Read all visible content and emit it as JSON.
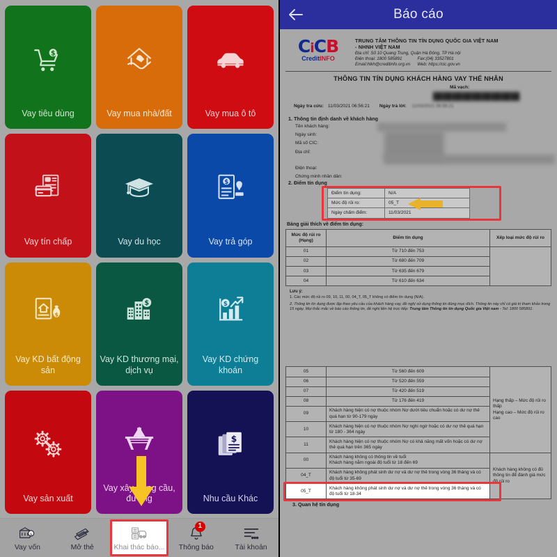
{
  "left_app": {
    "tiles": [
      {
        "label": "Vay tiêu dùng",
        "bg": "#11731b",
        "fg": "#cfe6cf",
        "icon": "shopping-cart-money-icon"
      },
      {
        "label": "Vay mua nhà/đất",
        "bg": "#d96c0a",
        "fg": "#fbe6cf",
        "icon": "house-hand-icon"
      },
      {
        "label": "Vay mua ô tô",
        "bg": "#cf0c12",
        "fg": "#f6d3d4",
        "icon": "car-icon"
      },
      {
        "label": "Vay tín chấp",
        "bg": "#c3111a",
        "fg": "#f5d3d5",
        "icon": "credit-card-document-icon"
      },
      {
        "label": "Vay du học",
        "bg": "#0d4b52",
        "fg": "#cfe3e5",
        "icon": "graduation-cap-icon"
      },
      {
        "label": "Vay trả góp",
        "bg": "#0b49a8",
        "fg": "#d5e2f4",
        "icon": "document-money-stamp-icon"
      },
      {
        "label": "Vay KD bất động sản",
        "bg": "#cc8b07",
        "fg": "#f8ebc8",
        "icon": "house-document-moneybag-icon"
      },
      {
        "label": "Vay KD thương mại, dịch vụ",
        "bg": "#0a5742",
        "fg": "#cfe5dd",
        "icon": "buildings-coin-icon"
      },
      {
        "label": "Vay KD chứng khoán",
        "bg": "#0d7e95",
        "fg": "#d3eaf0",
        "icon": "bar-chart-coin-icon"
      },
      {
        "label": "Vay sản xuất",
        "bg": "#c3090f",
        "fg": "#f6d2d3",
        "icon": "gears-icon"
      },
      {
        "label": "Vay xây dựng cầu, đường",
        "bg": "#7d1186",
        "fg": "#efd6f2",
        "icon": "bridge-road-icon"
      },
      {
        "label": "Nhu cầu Khác",
        "bg": "#141154",
        "fg": "#d5d4e8",
        "icon": "documents-money-icon"
      }
    ],
    "bottom_nav": [
      {
        "label": "Vay vốn",
        "icon": "bank-money-icon",
        "badge": null,
        "highlighted": false
      },
      {
        "label": "Mở thẻ",
        "icon": "cards-icon",
        "badge": null,
        "highlighted": false
      },
      {
        "label": "Khai thác báo...",
        "icon": "report-extract-icon",
        "badge": null,
        "highlighted": true
      },
      {
        "label": "Thông báo",
        "icon": "bell-icon",
        "badge": "1",
        "highlighted": false
      },
      {
        "label": "Tài khoản",
        "icon": "menu-account-icon",
        "badge": null,
        "highlighted": false
      }
    ],
    "annotations": {
      "down_arrow": "down-arrow-pointing-to-khai-thac-bao",
      "arrow_color": "#f7c325",
      "highlight_color": "#e8363c"
    }
  },
  "report": {
    "titlebar": {
      "back": "back-arrow-icon",
      "title": "Báo cáo"
    },
    "logo": {
      "main_c1": "C",
      "main_i": "i",
      "main_c2": "C",
      "main_b": "B",
      "sub_credit": "Credit",
      "sub_info": "INFO"
    },
    "org": {
      "name_line1": "TRUNG TÂM THÔNG TIN TÍN DỤNG QUỐC GIA VIỆT NAM",
      "name_line2": "- NHNH VIỆT NAM",
      "address": "Địa chỉ: Số 10 Quang Trung, Quận Hà Đông, TP Hà nội",
      "phone": "Điện thoại: 1800 585891",
      "fax": "Fax:(04) 33527801",
      "email": "Email:htkh@creditinfo.org.vn",
      "web": "Web: https://cic.gov.vn"
    },
    "doc_heading": "THÔNG TIN TÍN DỤNG KHÁCH HÀNG VAY THỂ NHÂN",
    "meta": {
      "barcode_label": "Mã vạch:",
      "lookup_label": "Ngày tra cứu:",
      "lookup_value": "11/03/2021 06:56:21",
      "reply_label": "Ngày trả lời:",
      "reply_value": "11/03/2021 06:56:21"
    },
    "section1": {
      "heading": "1. Thông tin định danh về khách hàng",
      "fields": [
        "Tên khách hàng:",
        "Ngày sinh:",
        "Mã số CIC:",
        "Địa chỉ:",
        "Điện thoại:",
        "Chứng minh nhân dân:"
      ]
    },
    "section2": {
      "heading": "2. Điểm tín dụng",
      "rows": [
        {
          "key": "Điểm tín dụng:",
          "value": "N/A"
        },
        {
          "key": "Mức độ rủi ro:",
          "value": "05_T"
        },
        {
          "key": "Ngày chấm điểm:",
          "value": "11/03/2021"
        }
      ],
      "table_caption": "Bảng giải thích về điểm tín dụng:",
      "headers": [
        "Mức độ rủi ro (Hạng)",
        "Điểm tín dụng",
        "Xếp loại mức độ rủi ro"
      ],
      "rows_top": [
        {
          "rank": "01",
          "score": "Từ 710 đến 753",
          "class": ""
        },
        {
          "rank": "02",
          "score": "Từ 680 đến 709",
          "class": ""
        },
        {
          "rank": "03",
          "score": "Từ 635 đến 679",
          "class": ""
        },
        {
          "rank": "04",
          "score": "Từ 610 đến 634",
          "class": ""
        }
      ],
      "rows_bottom": [
        {
          "rank": "05",
          "score": "Từ 560 đến 609",
          "center": true
        },
        {
          "rank": "06",
          "score": "Từ 520 đến 559",
          "center": true
        },
        {
          "rank": "07",
          "score": "Từ 420 đến 519",
          "center": true
        },
        {
          "rank": "08",
          "score": "Từ 176 đến 419",
          "center": true
        },
        {
          "rank": "09",
          "score": "Khách hàng hiện có nợ thuộc nhóm Nợ dưới tiêu chuẩn hoặc có dư nợ thẻ quá hạn từ 90-179 ngày",
          "center": false
        },
        {
          "rank": "10",
          "score": "Khách hàng hiện có nợ thuộc nhóm Nợ nghi ngờ hoặc có dư nợ thẻ quá hạn từ 180 - 364 ngày",
          "center": false
        },
        {
          "rank": "11",
          "score": "Khách hàng hiện có nợ thuộc nhóm Nợ có khả năng mất vốn hoặc có dư nợ thẻ quá hạn trên 365 ngày",
          "center": false
        },
        {
          "rank": "00",
          "score": "Khách hàng không có thông tin về tuổi\nKhách hàng nằm ngoài độ tuổi từ 18 đến 69",
          "center": false
        },
        {
          "rank": "04_T",
          "score": "Khách hàng không phát sinh dư nợ và dư nợ thẻ trong vòng 36 tháng và có độ tuổi từ 35-69",
          "center": false
        },
        {
          "rank": "05_T",
          "score": "Khách hàng không phát sinh dư nợ và dư nợ thẻ trong vòng 36 tháng và có độ tuổi từ 18-34",
          "center": false,
          "highlighted": true
        }
      ],
      "class_cell_1": "Hạng thấp – Mức độ rủi ro thấp\nHạng cao – Mức độ rủi ro cao",
      "class_cell_2": "Khách hàng không có đủ thông tin để đánh giá mức độ rủi ro"
    },
    "notes": {
      "head": "Lưu ý:",
      "n1": "1. Các mức độ rủi ro 09, 10, 11, 00, 04_T, 05_T không có điểm tín dụng (N/A).",
      "n2a": "2. Thông tin tín dụng được lập theo yêu cầu của khách hàng vay, đề nghị sử dụng thông tin đúng mục đích. Thông tin này chỉ có giá trị tham khảo trong 15 ngày. Mọi thắc mắc về báo cáo thông tin, đề nghị liên hệ trực tiếp: ",
      "n2b": "Trung tâm Thông tin tín dụng Quốc gia Việt nam",
      "n2c": " - Tel: 1800 585891."
    },
    "section3": {
      "heading": "3. Quan hệ tín dụng"
    }
  }
}
